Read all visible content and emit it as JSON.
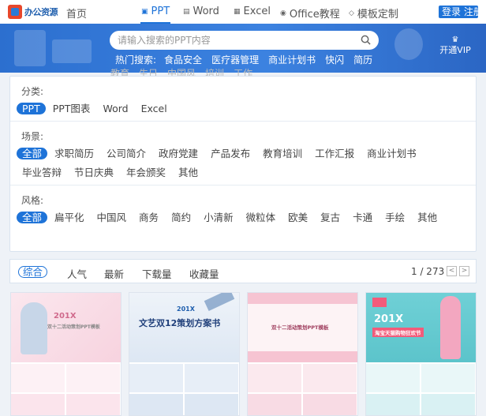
{
  "logo": {
    "text": "办公资源"
  },
  "nav": {
    "home": "首页",
    "ppt": "PPT",
    "word": "Word",
    "excel": "Excel",
    "office": "Office教程",
    "custom": "模板定制",
    "login": "登录 注册"
  },
  "search": {
    "placeholder": "请输入搜索的PPT内容"
  },
  "hot": {
    "label": "热门搜索:",
    "words": [
      "食品安全",
      "医疗器管理",
      "商业计划书",
      "快闪",
      "简历"
    ],
    "overflow": [
      "教育",
      "生日",
      "中国风",
      "培训",
      "工作"
    ]
  },
  "vip": {
    "icon": "crown-icon",
    "label": "开通VIP"
  },
  "filters": {
    "category": {
      "label": "分类:",
      "items": [
        "PPT",
        "PPT图表",
        "Word",
        "Excel"
      ],
      "selected": "PPT"
    },
    "scene": {
      "label": "场景:",
      "items": [
        "全部",
        "求职简历",
        "公司简介",
        "政府党建",
        "产品发布",
        "教育培训",
        "工作汇报",
        "商业计划书",
        "毕业答辩",
        "节日庆典",
        "年会颁奖",
        "其他"
      ],
      "selected": "全部"
    },
    "style": {
      "label": "风格:",
      "items": [
        "全部",
        "扁平化",
        "中国风",
        "商务",
        "简约",
        "小清新",
        "微粒体",
        "欧美",
        "复古",
        "卡通",
        "手绘",
        "其他"
      ],
      "selected": "全部"
    }
  },
  "sort": {
    "items": [
      "综合",
      "人气",
      "最新",
      "下载量",
      "收藏量"
    ],
    "selected": "综合",
    "page": "1 / 273",
    "prev": "<",
    "next": ">"
  },
  "cards": [
    {
      "title": "201X",
      "subtitle": "双十二活动策划PPT模板",
      "accent": "#f3a7c0"
    },
    {
      "title": "201X",
      "subtitle": "文艺双12策划方案书",
      "accent": "#1f5fae"
    },
    {
      "title": "双十二活动策划PPT模板",
      "subtitle": "",
      "accent": "#e87a9a"
    },
    {
      "title": "201X",
      "subtitle": "淘宝天猫购物狂欢节",
      "accent": "#f25b7a"
    }
  ],
  "colors": {
    "brand": "#1e73d8",
    "banner": "#2f74d4"
  }
}
